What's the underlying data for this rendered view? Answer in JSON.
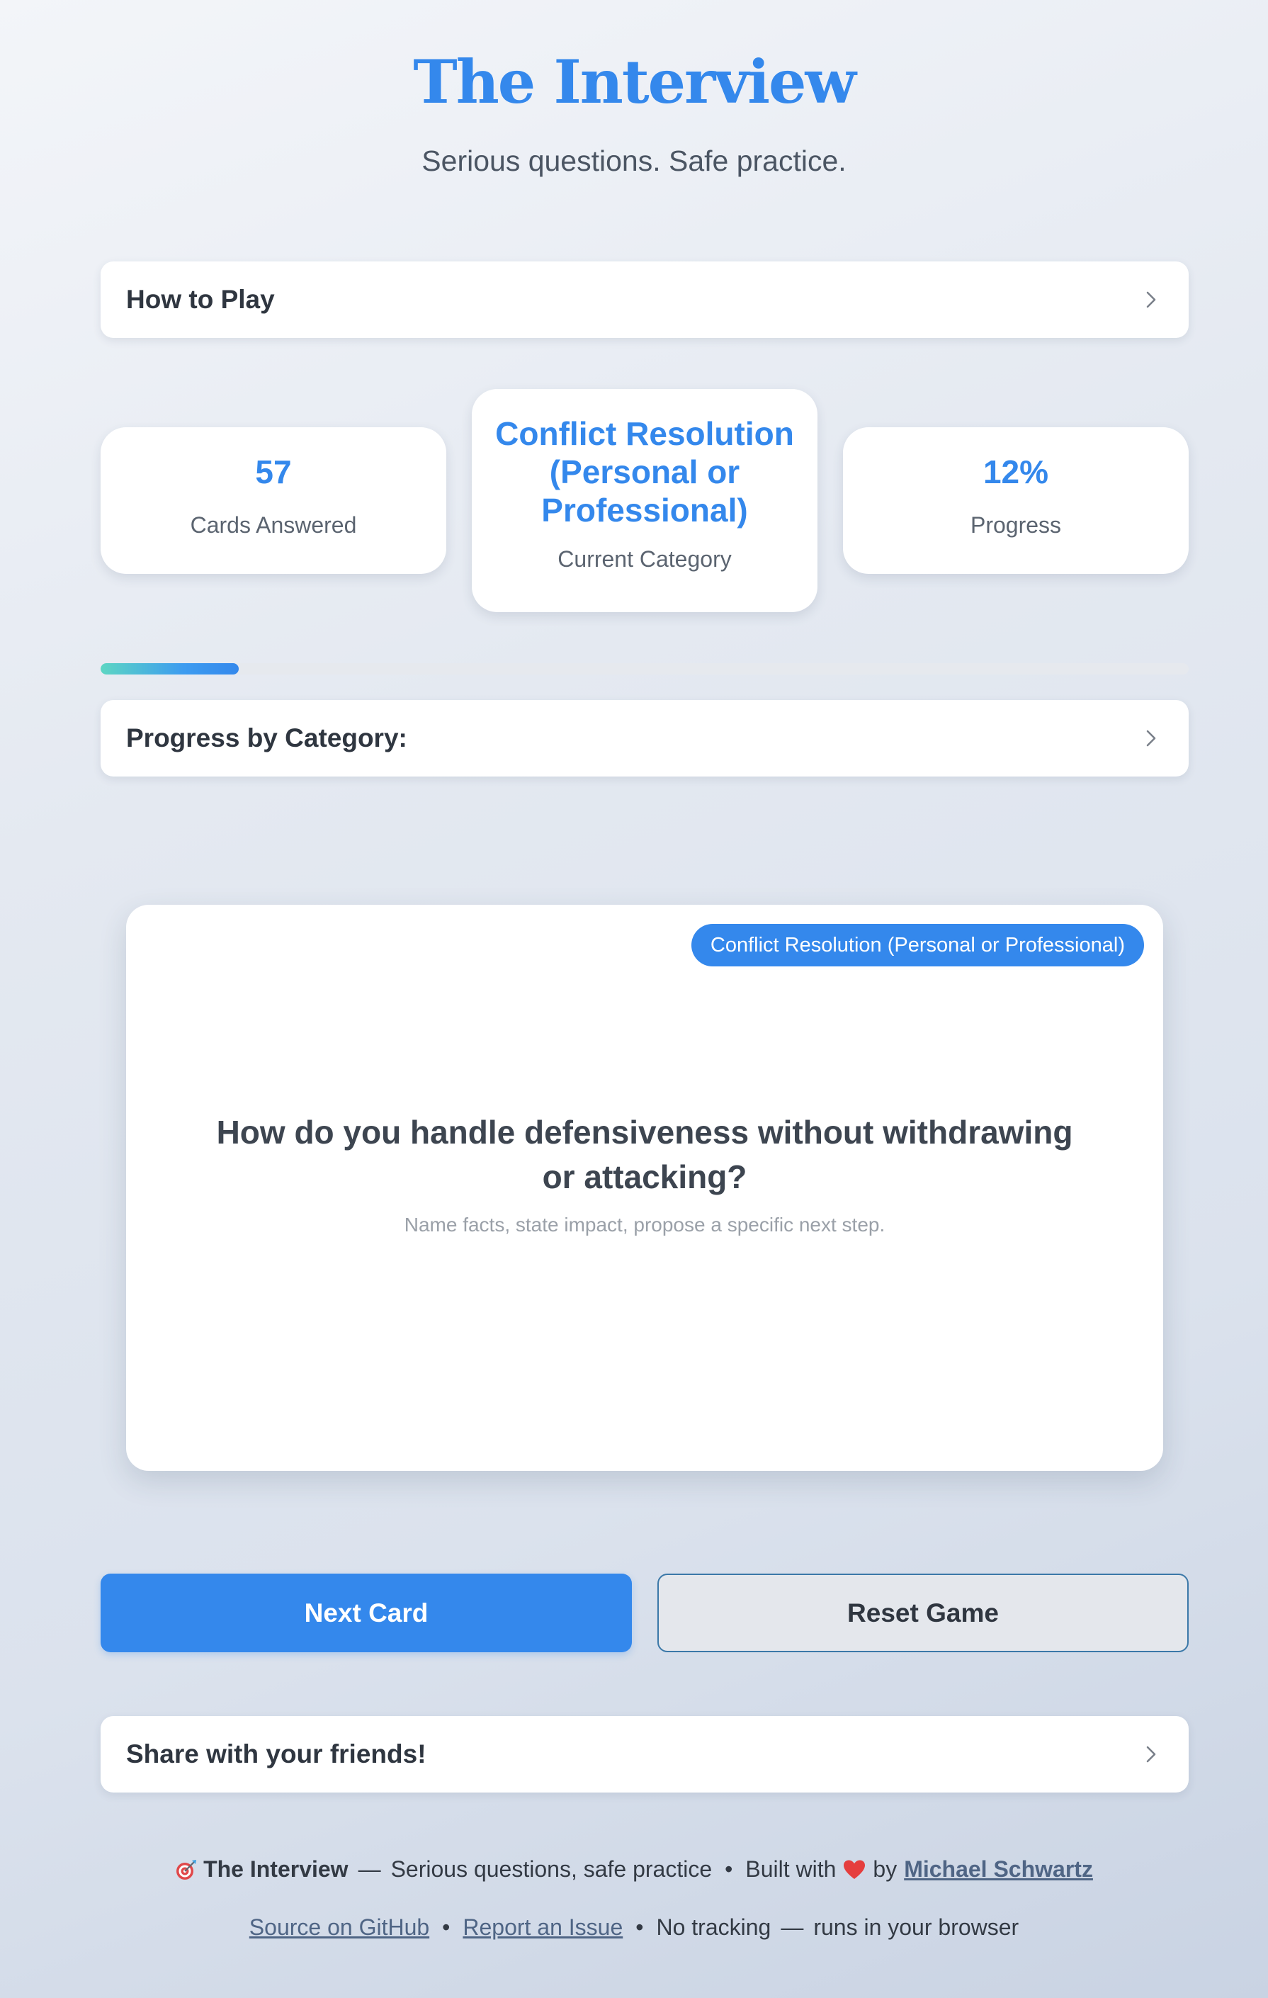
{
  "header": {
    "title": "The Interview",
    "subtitle": "Serious questions. Safe practice."
  },
  "how_to_play": {
    "label": "How to Play",
    "icon": "chevron-right-icon"
  },
  "stats": {
    "cards_answered": {
      "value": "57",
      "label": "Cards Answered"
    },
    "current_category": {
      "value": "Conflict Resolution (Personal or Professional)",
      "label": "Current Category"
    },
    "progress": {
      "value": "12%",
      "label": "Progress"
    }
  },
  "progress_bar": {
    "fraction": 0.127
  },
  "progress_by_category": {
    "label": "Progress by Category:",
    "icon": "chevron-right-icon"
  },
  "card": {
    "category_badge": "Conflict Resolution (Personal or Professional)",
    "question": "How do you handle defensiveness without withdrawing or attacking?",
    "hint": "Name facts, state impact, propose a specific next step."
  },
  "actions": {
    "next_label": "Next Card",
    "reset_label": "Reset Game"
  },
  "share": {
    "label": "Share with your friends!",
    "icon": "chevron-right-icon"
  },
  "footer": {
    "app_icon": "target-icon",
    "app_name": "The Interview",
    "dash": "—",
    "tagline": "Serious questions, safe practice",
    "bullet": "•",
    "built_with": "Built with",
    "heart_icon": "heart-icon",
    "by": "by",
    "author": "Michael Schwartz",
    "source_link": "Source on GitHub",
    "issue_link": "Report an Issue",
    "no_tracking": "No tracking",
    "runs_in_browser": "runs in your browser"
  },
  "colors": {
    "accent": "#3488ec",
    "heart": "#e53e3e",
    "progress_start": "#5dd6c3"
  }
}
